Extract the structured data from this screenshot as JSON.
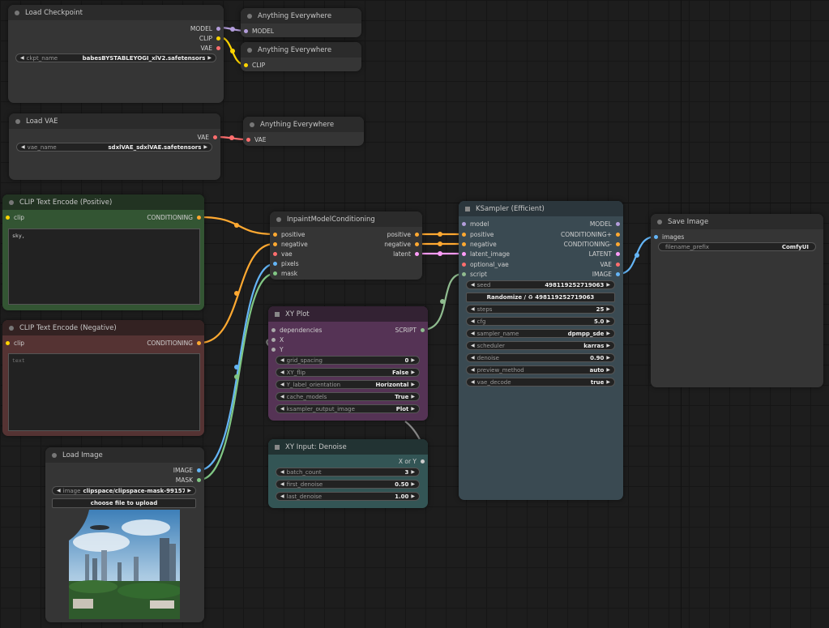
{
  "colors": {
    "model": "#b39ddb",
    "clip": "#ffd500",
    "vae": "#ff6e6e",
    "conditioning": "#ffa931",
    "latent": "#ff9cf9",
    "image": "#64b5f6",
    "mask": "#81c784",
    "script": "#8fbc8f"
  },
  "nodes": {
    "load_checkpoint": {
      "title": "Load Checkpoint",
      "outputs": [
        "MODEL",
        "CLIP",
        "VAE"
      ],
      "ckpt_label": "ckpt_name",
      "ckpt_value": "babesBYSTABLEYOGI_xlV2.safetensors"
    },
    "ae_model": {
      "title": "Anything Everywhere",
      "input": "MODEL"
    },
    "ae_clip": {
      "title": "Anything Everywhere",
      "input": "CLIP"
    },
    "load_vae": {
      "title": "Load VAE",
      "output": "VAE",
      "vae_label": "vae_name",
      "vae_value": "sdxlVAE_sdxlVAE.safetensors"
    },
    "ae_vae": {
      "title": "Anything Everywhere",
      "input": "VAE"
    },
    "clip_pos": {
      "title": "CLIP Text Encode (Positive)",
      "input": "clip",
      "output": "CONDITIONING",
      "text": "sky,"
    },
    "clip_neg": {
      "title": "CLIP Text Encode (Negative)",
      "input": "clip",
      "output": "CONDITIONING",
      "placeholder": "text"
    },
    "inpaint": {
      "title": "InpaintModelConditioning",
      "inputs": [
        "positive",
        "negative",
        "vae",
        "pixels",
        "mask"
      ],
      "outputs": [
        "positive",
        "negative",
        "latent"
      ]
    },
    "ksampler": {
      "title": "KSampler (Efficient)",
      "inputs": [
        "model",
        "positive",
        "negative",
        "latent_image",
        "optional_vae",
        "script"
      ],
      "outputs": [
        "MODEL",
        "CONDITIONING+",
        "CONDITIONING-",
        "LATENT",
        "VAE",
        "IMAGE"
      ],
      "seed_label": "seed",
      "seed_value": "498119252719063",
      "randomize_label": "Randomize / ♻ 498119252719063",
      "widgets": [
        {
          "label": "steps",
          "value": "25"
        },
        {
          "label": "cfg",
          "value": "5.0"
        },
        {
          "label": "sampler_name",
          "value": "dpmpp_sde"
        },
        {
          "label": "scheduler",
          "value": "karras"
        },
        {
          "label": "denoise",
          "value": "0.90"
        },
        {
          "label": "preview_method",
          "value": "auto"
        },
        {
          "label": "vae_decode",
          "value": "true"
        }
      ]
    },
    "save_image": {
      "title": "Save Image",
      "input": "images",
      "prefix_label": "filename_prefix",
      "prefix_value": "ComfyUI"
    },
    "xy_plot": {
      "title": "XY Plot",
      "inputs": [
        "dependencies",
        "X",
        "Y"
      ],
      "output": "SCRIPT",
      "widgets": [
        {
          "label": "grid_spacing",
          "value": "0"
        },
        {
          "label": "XY_flip",
          "value": "False"
        },
        {
          "label": "Y_label_orientation",
          "value": "Horizontal"
        },
        {
          "label": "cache_models",
          "value": "True"
        },
        {
          "label": "ksampler_output_image",
          "value": "Plot"
        }
      ]
    },
    "xy_denoise": {
      "title": "XY Input: Denoise",
      "output": "X or Y",
      "widgets": [
        {
          "label": "batch_count",
          "value": "3"
        },
        {
          "label": "first_denoise",
          "value": "0.50"
        },
        {
          "label": "last_denoise",
          "value": "1.00"
        }
      ]
    },
    "load_image": {
      "title": "Load Image",
      "outputs": [
        "IMAGE",
        "MASK"
      ],
      "image_label": "image",
      "image_value": "clipspace/clipspace-mask-991571...",
      "upload_label": "choose file to upload"
    }
  }
}
